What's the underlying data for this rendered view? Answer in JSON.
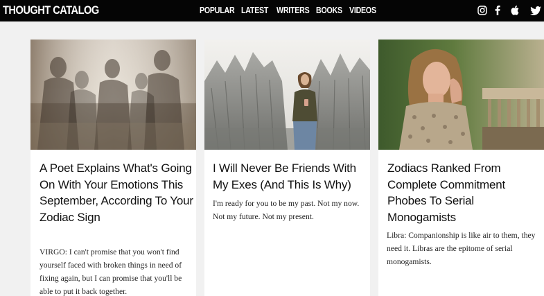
{
  "header": {
    "logo": "THOUGHT CATALOG",
    "nav": [
      "POPULAR",
      "LATEST",
      "WRITERS",
      "BOOKS",
      "VIDEOS"
    ],
    "social_icons": [
      "instagram-icon",
      "facebook-icon",
      "apple-icon",
      "twitter-icon"
    ],
    "background": "#050505"
  },
  "articles": [
    {
      "title": "A Poet Explains What's Going On With Your Emotions This September, According To Your Zodiac Sign",
      "excerpt": "VIRGO: I can't promise that you won't find yourself faced with broken things in need of fixing again, but I can promise that you'll be able to put it back together."
    },
    {
      "title": "I Will Never Be Friends With My Exes (And This Is Why)",
      "excerpt": "I'm ready for you to be my past. Not my now. Not my future. Not my present."
    },
    {
      "title": "Zodiacs Ranked From Complete Commitment Phobes To Serial Monogamists",
      "excerpt": "Libra: Companionship is like air to them, they need it. Libras are the epitome of serial monogamists."
    }
  ],
  "colors": {
    "page_background": "#f1f1f1",
    "card_background": "#ffffff",
    "text": "#111111"
  }
}
